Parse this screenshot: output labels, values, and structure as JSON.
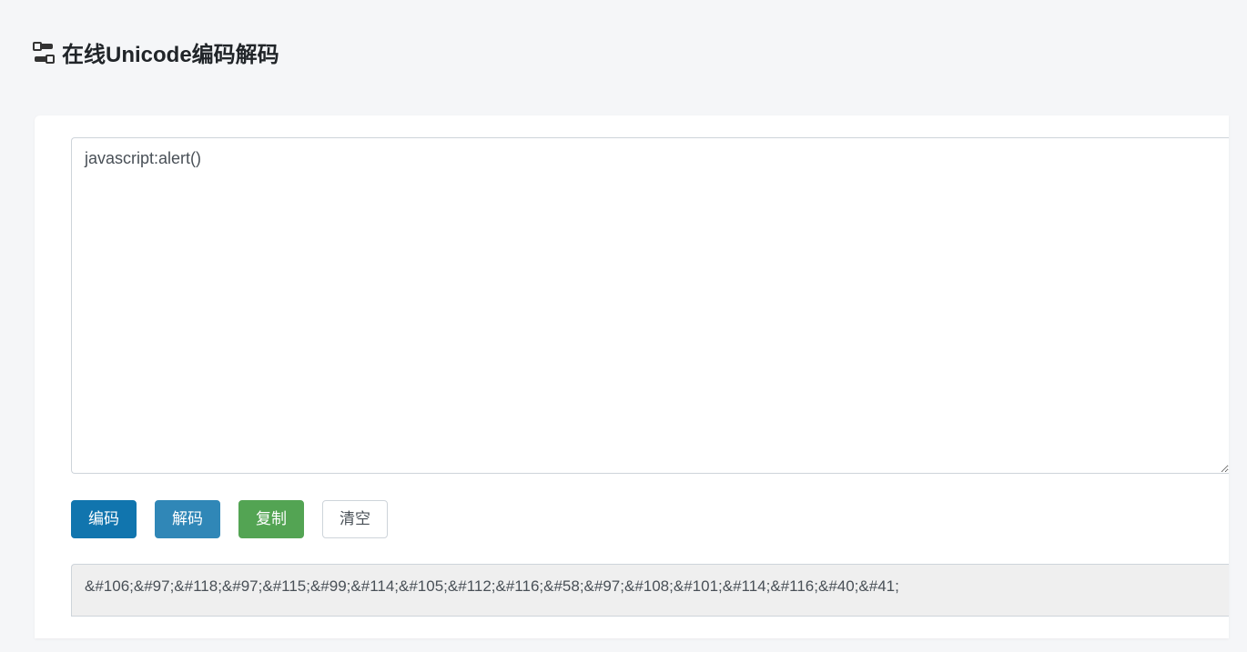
{
  "header": {
    "title": "在线Unicode编码解码"
  },
  "input": {
    "value": "javascript:alert()",
    "placeholder": ""
  },
  "buttons": {
    "encode": "编码",
    "decode": "解码",
    "copy": "复制",
    "clear": "清空"
  },
  "output": {
    "value": "&#106;&#97;&#118;&#97;&#115;&#99;&#114;&#105;&#112;&#116;&#58;&#97;&#108;&#101;&#114;&#116;&#40;&#41;"
  }
}
